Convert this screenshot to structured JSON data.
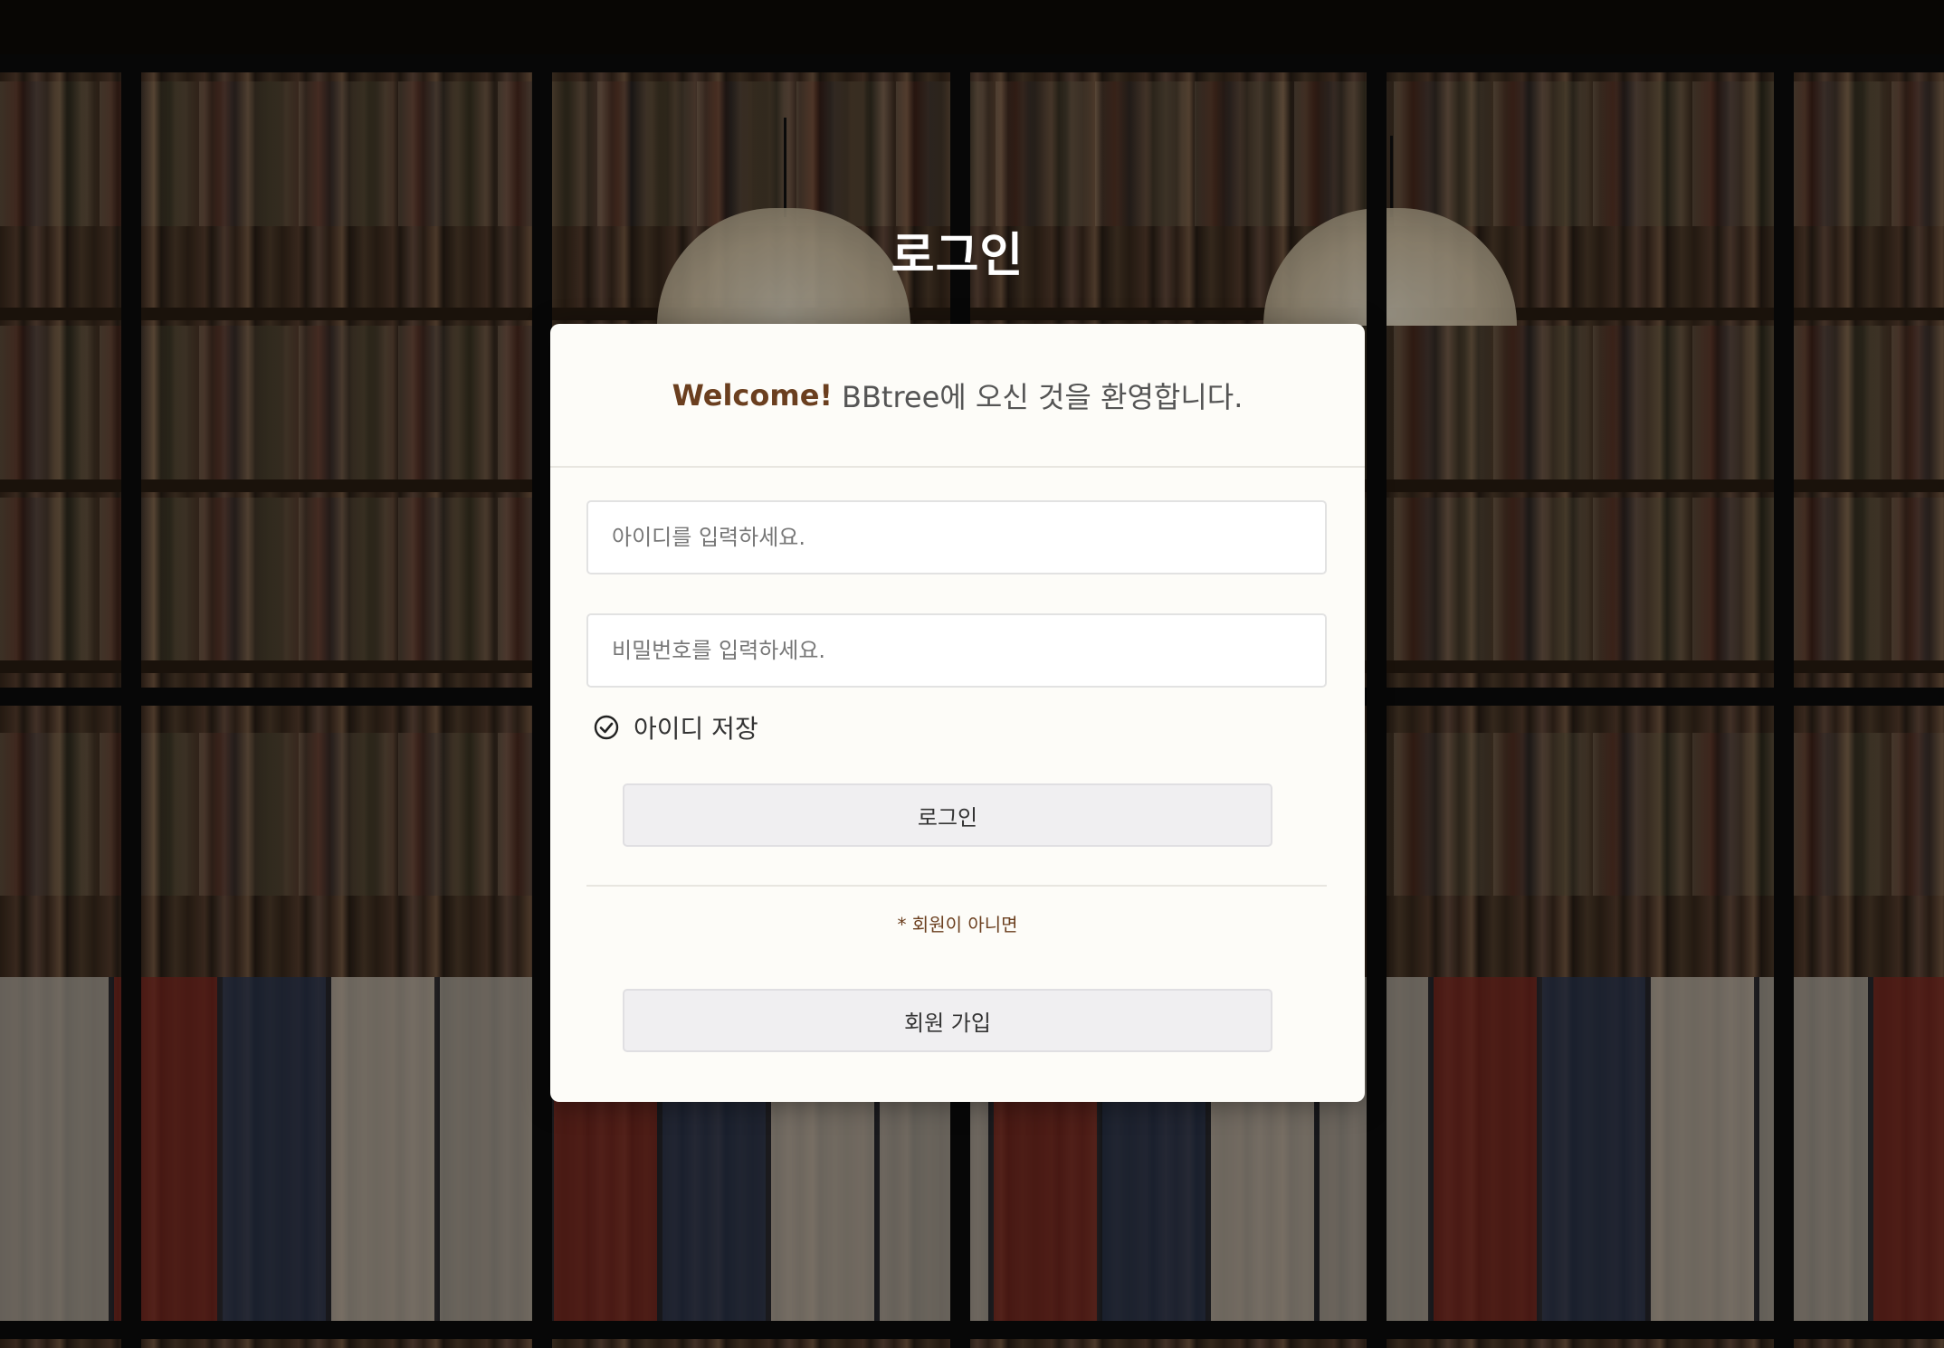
{
  "page": {
    "title": "로그인"
  },
  "card": {
    "welcome_bold": "Welcome!",
    "welcome_text": "BBtree에 오신 것을 환영합니다."
  },
  "form": {
    "id_placeholder": "아이디를 입력하세요.",
    "id_value": "",
    "password_placeholder": "비밀번호를 입력하세요.",
    "password_value": "",
    "remember_label": "아이디 저장",
    "remember_icon": "check-circle-icon",
    "login_button": "로그인",
    "signup_note": "* 회원이 아니면",
    "signup_button": "회원 가입"
  },
  "colors": {
    "accent": "#6b3f1f",
    "card_bg": "#fdfcf8",
    "button_bg": "#f0eff1"
  }
}
